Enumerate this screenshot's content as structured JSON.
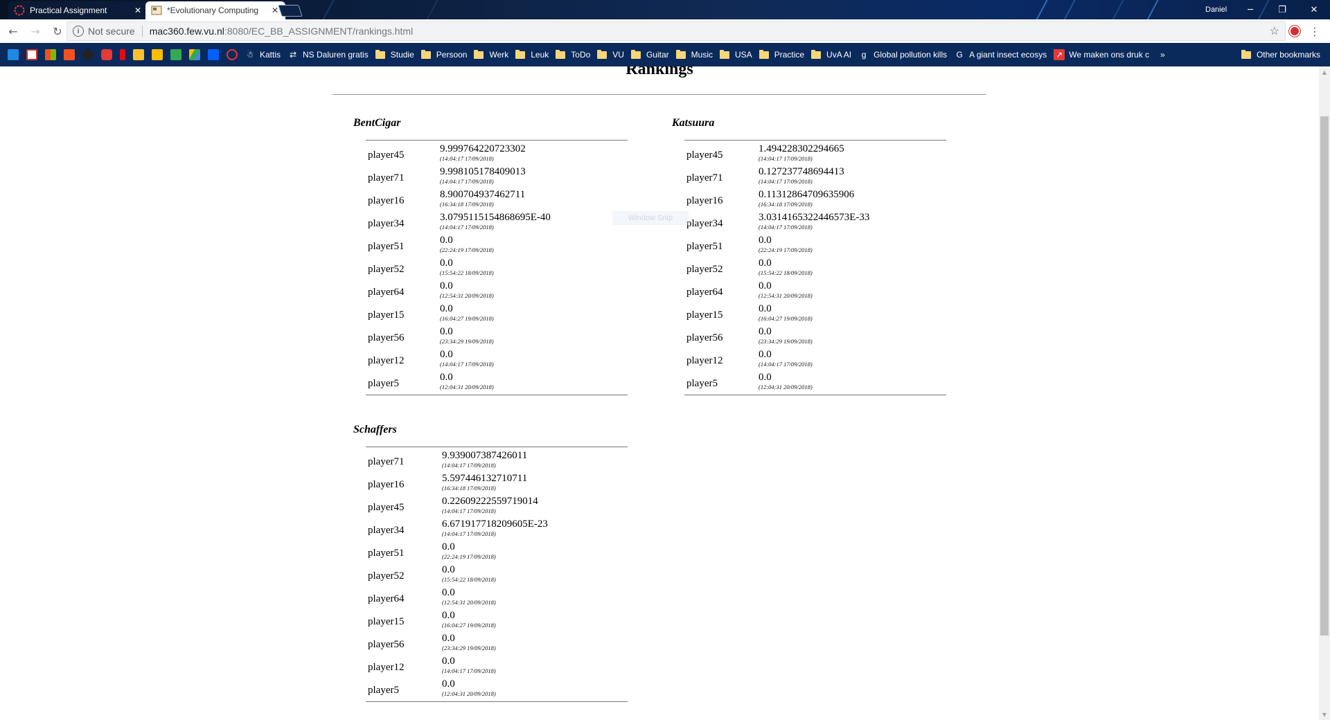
{
  "browser": {
    "tabs": [
      {
        "title": "Practical Assignment",
        "active": false
      },
      {
        "title": "*Evolutionary Computing",
        "active": true
      }
    ],
    "user": "Daniel",
    "address": {
      "security": "Not secure",
      "host": "mac360.few.vu.nl",
      "path": ":8080/EC_BB_ASSIGNMENT/rankings.html"
    },
    "bookmarks": [
      "Kattis",
      "NS Daluren gratis",
      "Studie",
      "Persoon",
      "Werk",
      "Leuk",
      "ToDo",
      "VU",
      "Guitar",
      "Music",
      "USA",
      "Practice",
      "UvA AI",
      "Global pollution kills",
      "A giant insect ecosys",
      "We maken ons druk c"
    ],
    "overflow": "»",
    "other_bookmarks": "Other bookmarks",
    "icons": [
      "back-icon",
      "forward-icon",
      "reload-icon",
      "info-icon",
      "star-icon",
      "menu-icon"
    ]
  },
  "page": {
    "title": "Rankings",
    "overlay_label": "Window Snip",
    "sections": [
      {
        "name": "BentCigar",
        "entries": [
          {
            "player": "player45",
            "value": "9.999764220723302",
            "time": "(14:04:17 17/09/2018)"
          },
          {
            "player": "player71",
            "value": "9.998105178409013",
            "time": "(14:04:17 17/09/2018)"
          },
          {
            "player": "player16",
            "value": "8.900704937462711",
            "time": "(16:34:18 17/09/2018)"
          },
          {
            "player": "player34",
            "value": "3.0795115154868695E-40",
            "time": "(14:04:17 17/09/2018)"
          },
          {
            "player": "player51",
            "value": "0.0",
            "time": "(22:24:19 17/09/2018)"
          },
          {
            "player": "player52",
            "value": "0.0",
            "time": "(15:54:22 18/09/2018)"
          },
          {
            "player": "player64",
            "value": "0.0",
            "time": "(12:54:31 20/09/2018)"
          },
          {
            "player": "player15",
            "value": "0.0",
            "time": "(16:04:27 19/09/2018)"
          },
          {
            "player": "player56",
            "value": "0.0",
            "time": "(23:34:29 19/09/2018)"
          },
          {
            "player": "player12",
            "value": "0.0",
            "time": "(14:04:17 17/09/2018)"
          },
          {
            "player": "player5",
            "value": "0.0",
            "time": "(12:04:31 20/09/2018)"
          }
        ]
      },
      {
        "name": "Katsuura",
        "entries": [
          {
            "player": "player45",
            "value": "1.494228302294665",
            "time": "(14:04:17 17/09/2018)"
          },
          {
            "player": "player71",
            "value": "0.127237748694413",
            "time": "(14:04:17 17/09/2018)"
          },
          {
            "player": "player16",
            "value": "0.11312864709635906",
            "time": "(16:34:18 17/09/2018)"
          },
          {
            "player": "player34",
            "value": "3.0314165322446573E-33",
            "time": "(14:04:17 17/09/2018)"
          },
          {
            "player": "player51",
            "value": "0.0",
            "time": "(22:24:19 17/09/2018)"
          },
          {
            "player": "player52",
            "value": "0.0",
            "time": "(15:54:22 18/09/2018)"
          },
          {
            "player": "player64",
            "value": "0.0",
            "time": "(12:54:31 20/09/2018)"
          },
          {
            "player": "player15",
            "value": "0.0",
            "time": "(16:04:27 19/09/2018)"
          },
          {
            "player": "player56",
            "value": "0.0",
            "time": "(23:34:29 19/09/2018)"
          },
          {
            "player": "player12",
            "value": "0.0",
            "time": "(14:04:17 17/09/2018)"
          },
          {
            "player": "player5",
            "value": "0.0",
            "time": "(12:04:31 20/09/2018)"
          }
        ]
      },
      {
        "name": "Schaffers",
        "entries": [
          {
            "player": "player71",
            "value": "9.939007387426011",
            "time": "(14:04:17 17/09/2018)"
          },
          {
            "player": "player16",
            "value": "5.597446132710711",
            "time": "(16:34:18 17/09/2018)"
          },
          {
            "player": "player45",
            "value": "0.22609222559719014",
            "time": "(14:04:17 17/09/2018)"
          },
          {
            "player": "player34",
            "value": "6.671917718209605E-23",
            "time": "(14:04:17 17/09/2018)"
          },
          {
            "player": "player51",
            "value": "0.0",
            "time": "(22:24:19 17/09/2018)"
          },
          {
            "player": "player52",
            "value": "0.0",
            "time": "(15:54:22 18/09/2018)"
          },
          {
            "player": "player64",
            "value": "0.0",
            "time": "(12:54:31 20/09/2018)"
          },
          {
            "player": "player15",
            "value": "0.0",
            "time": "(16:04:27 19/09/2018)"
          },
          {
            "player": "player56",
            "value": "0.0",
            "time": "(23:34:29 19/09/2018)"
          },
          {
            "player": "player12",
            "value": "0.0",
            "time": "(14:04:17 17/09/2018)"
          },
          {
            "player": "player5",
            "value": "0.0",
            "time": "(12:04:31 20/09/2018)"
          }
        ]
      }
    ]
  }
}
